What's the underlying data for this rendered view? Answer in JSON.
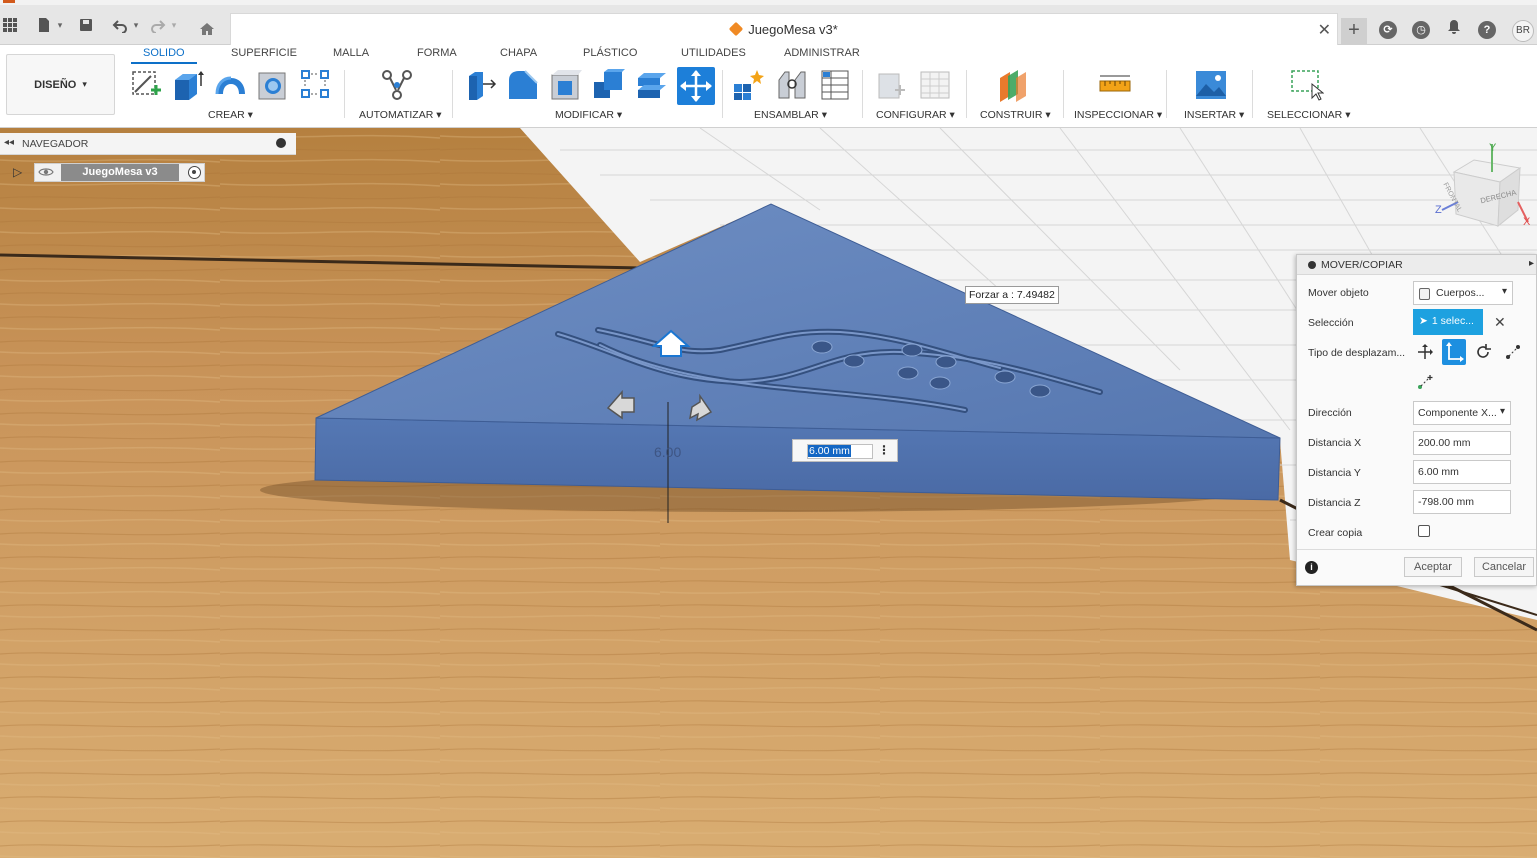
{
  "window": {
    "doc_title": "JuegoMesa v3*",
    "user_initials": "BR"
  },
  "ribbon": {
    "workspace": "DISEÑO",
    "tabs": [
      {
        "label": "SOLIDO",
        "active": true
      },
      {
        "label": "SUPERFICIE",
        "active": false
      },
      {
        "label": "MALLA",
        "active": false
      },
      {
        "label": "FORMA",
        "active": false
      },
      {
        "label": "CHAPA",
        "active": false
      },
      {
        "label": "PLÁSTICO",
        "active": false
      },
      {
        "label": "UTILIDADES",
        "active": false
      },
      {
        "label": "ADMINISTRAR",
        "active": false
      }
    ],
    "groups": {
      "crear": "CREAR",
      "automatizar": "AUTOMATIZAR",
      "modificar": "MODIFICAR",
      "ensamblar": "ENSAMBLAR",
      "configurar": "CONFIGURAR",
      "construir": "CONSTRUIR",
      "inspeccionar": "INSPECCIONAR",
      "insertar": "INSERTAR",
      "seleccionar": "SELECCIONAR"
    }
  },
  "browser": {
    "title": "NAVEGADOR",
    "root_item": "JuegoMesa v3"
  },
  "viewcube": {
    "face_right": "DERECHA",
    "face_front": "FRONTAL",
    "axis_x": "X",
    "axis_y": "Y",
    "axis_z": "Z"
  },
  "viewport": {
    "snap_tooltip": "Forzar a : 7.49482",
    "distance_input": "6.00 mm",
    "dimension_text": "6.00"
  },
  "dialog": {
    "title": "MOVER/COPIAR",
    "mover_objeto_label": "Mover objeto",
    "mover_objeto_value": "Cuerpos...",
    "seleccion_label": "Selección",
    "seleccion_value": "1 selec...",
    "tipo_label": "Tipo de desplazam...",
    "direccion_label": "Dirección",
    "direccion_value": "Componente X...",
    "distancia_x_label": "Distancia X",
    "distancia_x_value": "200.00 mm",
    "distancia_y_label": "Distancia Y",
    "distancia_y_value": "6.00 mm",
    "distancia_z_label": "Distancia Z",
    "distancia_z_value": "-798.00 mm",
    "crear_copia_label": "Crear copia",
    "crear_copia_checked": false,
    "ok_label": "Aceptar",
    "cancel_label": "Cancelar"
  },
  "colors": {
    "accent": "#0d70c8",
    "selection_blue": "#1da1e0",
    "body_blue": "#5e7fb5",
    "wood": "#c9945a"
  }
}
